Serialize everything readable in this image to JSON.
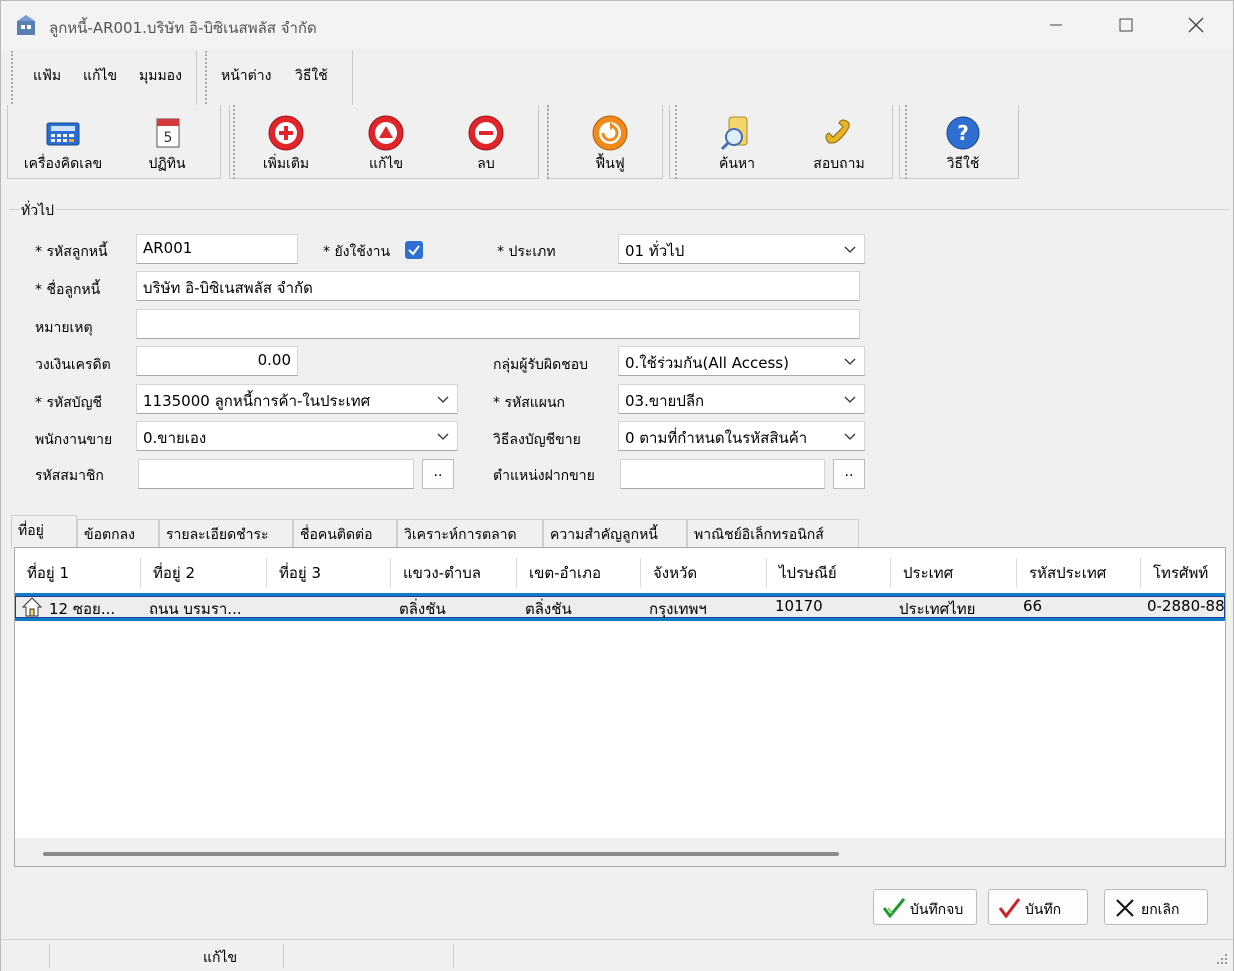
{
  "window": {
    "title": "ลูกหนี้-AR001.บริษัท อิ-บิซิเนสพลัส จำกัด"
  },
  "menu": {
    "items": [
      "แฟ้ม",
      "แก้ไข",
      "มุมมอง",
      "หน้าต่าง",
      "วิธีใช้"
    ]
  },
  "toolbar": {
    "calculator": "เครื่องคิดเลข",
    "calendar": "ปฏิทิน",
    "add": "เพิ่มเติม",
    "edit": "แก้ไข",
    "delete": "ลบ",
    "restore": "ฟื้นฟู",
    "search": "ค้นหา",
    "inquiry": "สอบถาม",
    "help": "วิธีใช้"
  },
  "general": {
    "title": "ทั่วไป",
    "labels": {
      "code": "* รหัสลูกหนี้",
      "active": "* ยังใช้งาน",
      "type": "* ประเภท",
      "name": "* ชื่อลูกหนี้",
      "remark": "หมายเหตุ",
      "credit": "วงเงินเครดิต",
      "resp_group": "กลุ่มผู้รับผิดชอบ",
      "account": "* รหัสบัญชี",
      "dept": "* รหัสแผนก",
      "salesman": "พนักงานขาย",
      "post_method": "วิธีลงบัญชีขาย",
      "member": "รหัสสมาชิก",
      "position": "ตำแหน่งฝากขาย"
    },
    "values": {
      "code": "AR001",
      "active": true,
      "type": "01 ทั่วไป",
      "name": "บริษัท อิ-บิซิเนสพลัส จำกัด",
      "remark": "",
      "credit": "0.00",
      "resp_group": "0.ใช้ร่วมกัน(All Access)",
      "account": "1135000 ลูกหนี้การค้า-ในประเทศ",
      "dept": "03.ขายปลีก",
      "salesman": "0.ขายเอง",
      "post_method": "0 ตามที่กำหนดในรหัสสินค้า",
      "member": "",
      "position": ""
    },
    "browse": ".."
  },
  "tabs": [
    "ที่อยู่",
    "ข้อตกลง",
    "รายละเอียดชำระ",
    "ชื่อคนติดต่อ",
    "วิเคราะห์การตลาด",
    "ความสำคัญลูกหนี้",
    "พาณิชย์อิเล็กทรอนิกส์"
  ],
  "grid": {
    "headers": [
      "ที่อยู่ 1",
      "ที่อยู่ 2",
      "ที่อยู่ 3",
      "แขวง-ตำบล",
      "เขต-อำเภอ",
      "จังหวัด",
      "ไปรษณีย์",
      "ประเทศ",
      "รหัสประเทศ",
      "โทรศัพท์"
    ],
    "rows": [
      [
        "12 ซอย...",
        "ถนน บรมรา...",
        "",
        "ตลิ่งชัน",
        "ตลิ่งชัน",
        "กรุงเทพฯ",
        "10170",
        "ประเทศไทย",
        "66",
        "0-2880-88"
      ]
    ]
  },
  "buttons": {
    "save_close": "บันทึกจบ",
    "save": "บันทึก",
    "cancel": "ยกเลิก"
  },
  "status": {
    "mode": "แก้ไข"
  },
  "colors": {
    "accent": "#2f6fd1",
    "selection": "#0f7cc8",
    "red": "#e0262b",
    "orange": "#f08a1c"
  }
}
